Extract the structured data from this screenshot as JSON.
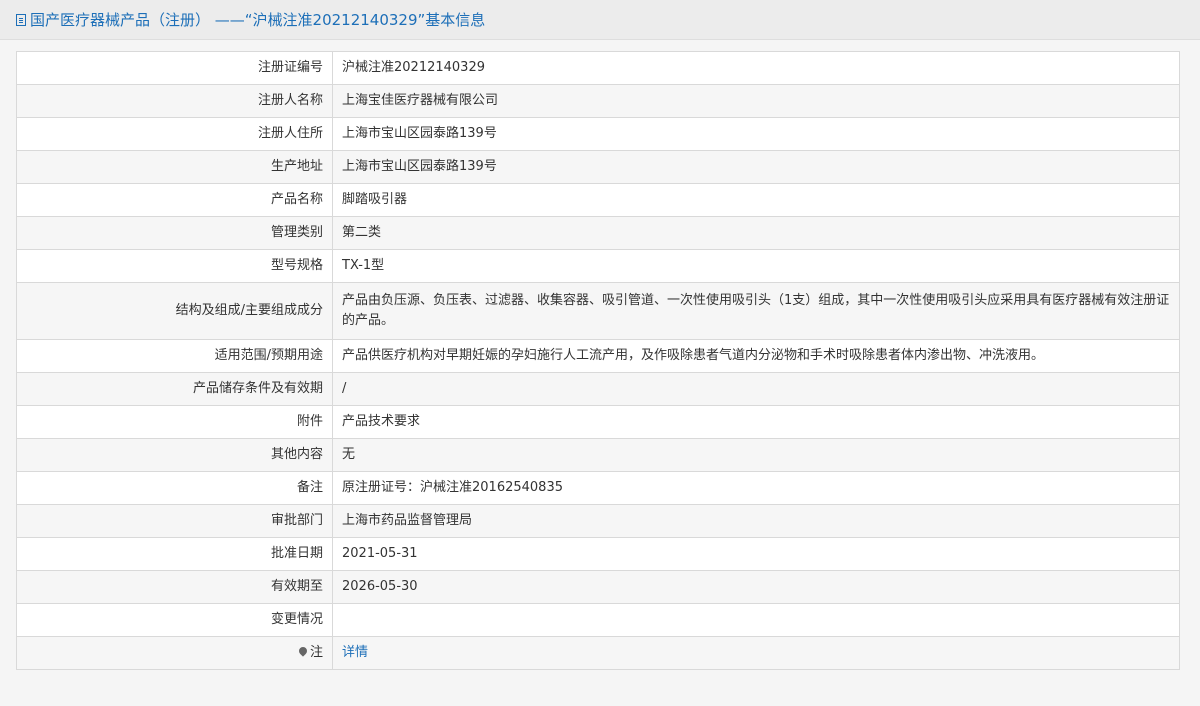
{
  "header": {
    "title": "国产医疗器械产品（注册） ——“沪械注准20212140329”基本信息"
  },
  "rows": [
    {
      "label": "注册证编号",
      "value": "沪械注准20212140329"
    },
    {
      "label": "注册人名称",
      "value": "上海宝佳医疗器械有限公司"
    },
    {
      "label": "注册人住所",
      "value": "上海市宝山区园泰路139号"
    },
    {
      "label": "生产地址",
      "value": "上海市宝山区园泰路139号"
    },
    {
      "label": "产品名称",
      "value": "脚踏吸引器"
    },
    {
      "label": "管理类别",
      "value": "第二类"
    },
    {
      "label": "型号规格",
      "value": "TX-1型"
    },
    {
      "label": "结构及组成/主要组成成分",
      "value": "产品由负压源、负压表、过滤器、收集容器、吸引管道、一次性使用吸引头（1支）组成，其中一次性使用吸引头应采用具有医疗器械有效注册证的产品。"
    },
    {
      "label": "适用范围/预期用途",
      "value": "产品供医疗机构对早期妊娠的孕妇施行人工流产用，及作吸除患者气道内分泌物和手术时吸除患者体内渗出物、冲洗液用。"
    },
    {
      "label": "产品储存条件及有效期",
      "value": "/"
    },
    {
      "label": "附件",
      "value": "产品技术要求"
    },
    {
      "label": "其他内容",
      "value": "无"
    },
    {
      "label": "备注",
      "value": "原注册证号：沪械注准20162540835"
    },
    {
      "label": "审批部门",
      "value": "上海市药品监督管理局"
    },
    {
      "label": "批准日期",
      "value": "2021-05-31"
    },
    {
      "label": "有效期至",
      "value": "2026-05-30"
    },
    {
      "label": "变更情况",
      "value": ""
    },
    {
      "label": "注",
      "value": "详情"
    }
  ],
  "icons": {
    "header": "document-icon",
    "note": "pin-icon"
  },
  "colors": {
    "accent": "#1d6fb8",
    "header_bg": "#ececec",
    "row_alt": "#f6f6f6",
    "border": "#d9d9d9"
  }
}
